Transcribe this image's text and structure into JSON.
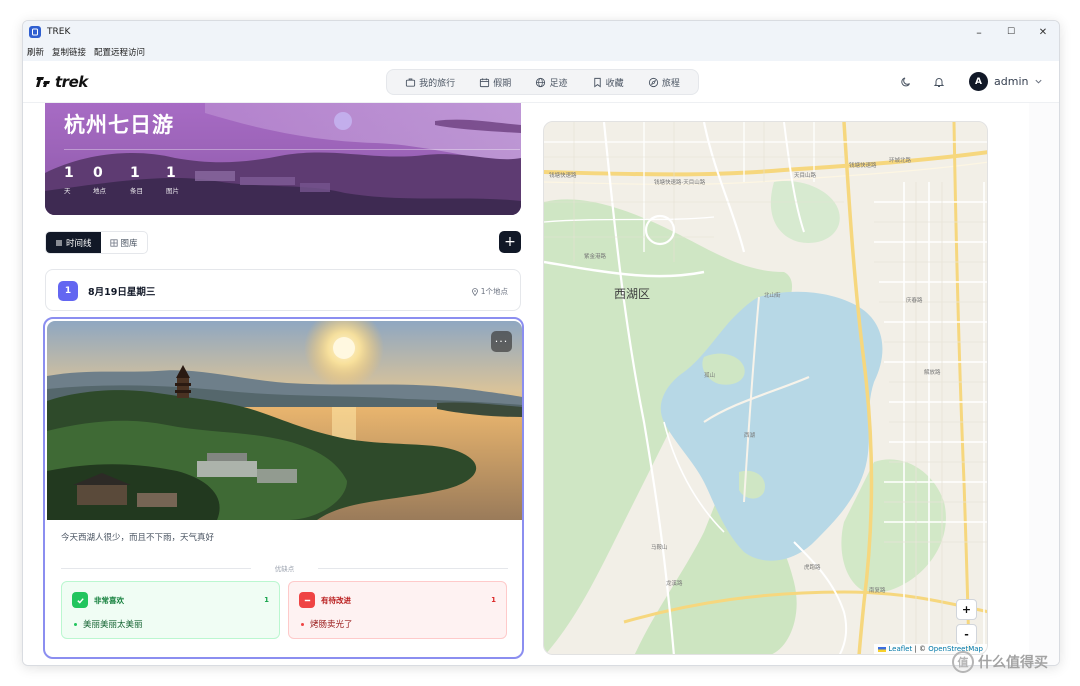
{
  "window": {
    "title": "TREK",
    "controls": {
      "minimize": "–",
      "maximize": "☐",
      "close": "✕"
    }
  },
  "menu": {
    "items": [
      "刷新",
      "复制链接",
      "配置远程访问"
    ]
  },
  "header": {
    "logo": "trek",
    "nav": [
      {
        "label": "我的旅行",
        "icon": "briefcase-icon"
      },
      {
        "label": "假期",
        "icon": "calendar-icon"
      },
      {
        "label": "足迹",
        "icon": "globe-icon"
      },
      {
        "label": "收藏",
        "icon": "bookmark-icon"
      },
      {
        "label": "旅程",
        "icon": "compass-icon"
      }
    ],
    "user": {
      "initial": "A",
      "name": "admin"
    }
  },
  "trip": {
    "title": "杭州七日游",
    "stats": [
      {
        "value": "1",
        "label": "天"
      },
      {
        "value": "0",
        "label": "地点"
      },
      {
        "value": "1",
        "label": "条目"
      },
      {
        "value": "1",
        "label": "图片"
      }
    ]
  },
  "tabs": [
    {
      "label": "时间线",
      "active": true
    },
    {
      "label": "图库",
      "active": false
    }
  ],
  "add_button": "+",
  "day": {
    "number": "1",
    "title": "8月19日星期三",
    "meta": "1个地点"
  },
  "entry": {
    "note": "今天西湖人很少，而且不下雨，天气真好",
    "review_label": "优缺点",
    "more": "···",
    "good": {
      "title": "非常喜欢",
      "count": "1",
      "item": "美丽美丽太美丽"
    },
    "bad": {
      "title": "有待改进",
      "count": "1",
      "item": "烤肠卖光了"
    }
  },
  "map": {
    "district": "西湖区",
    "zoom_in": "+",
    "zoom_out": "-",
    "attribution_leaflet": "Leaflet",
    "attribution_sep": " | © ",
    "attribution_osm": "OpenStreetMap"
  },
  "watermark": {
    "icon": "值",
    "text": "什么值得买"
  },
  "colors": {
    "accent": "#6366f1",
    "dark": "#111827",
    "good": "#22c55e",
    "bad": "#ef4444",
    "lake": "#b7d8e6",
    "park": "#c8e6c2"
  }
}
